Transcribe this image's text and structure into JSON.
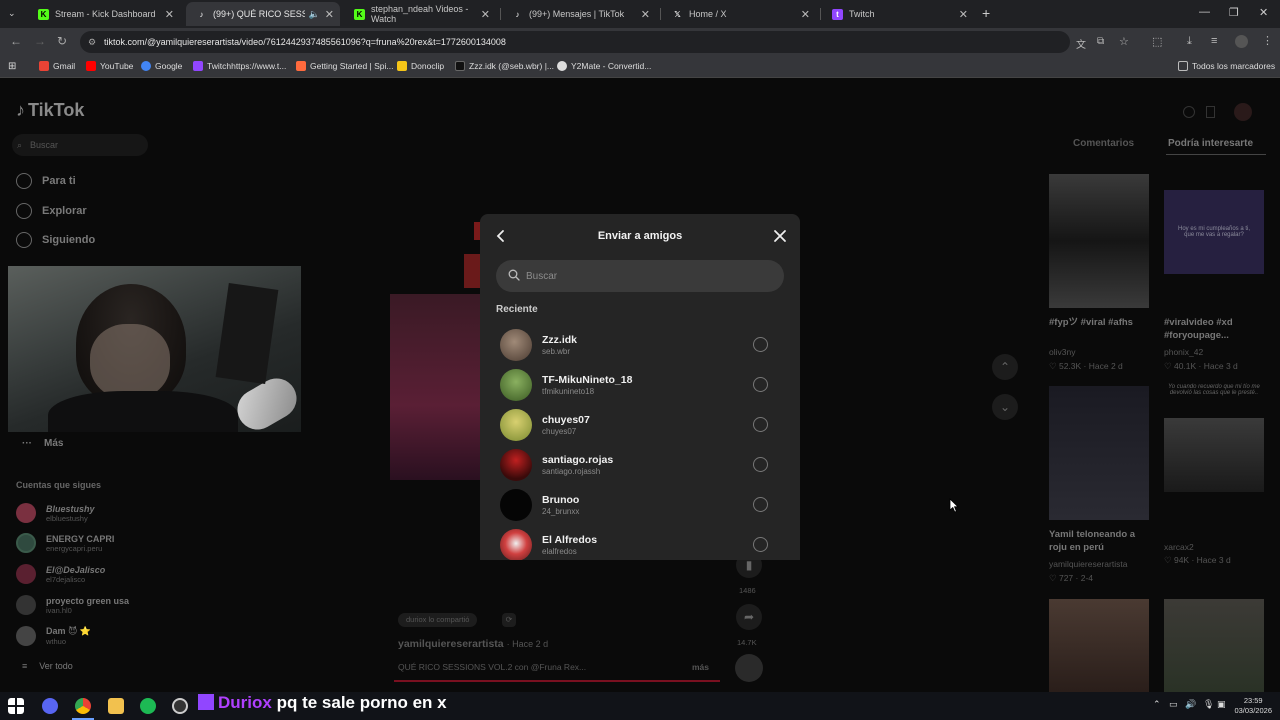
{
  "browser": {
    "tabs": [
      {
        "label": "Stream - Kick Dashboard",
        "favicon_color": "#53fc18"
      },
      {
        "label": "(99+) QUÉ RICO SESSIONS V",
        "favicon_color": "#ffffff"
      },
      {
        "label": "stephan_ndeah Videos - Watch",
        "favicon_color": "#53fc18"
      },
      {
        "label": "(99+) Mensajes | TikTok",
        "favicon_color": "#ffffff"
      },
      {
        "label": "Home / X",
        "favicon_color": "#ffffff"
      },
      {
        "label": "Twitch",
        "favicon_color": "#9146ff"
      }
    ],
    "url": "tiktok.com/@yamilquiereserartista/video/7612442937485561096?q=fruna%20rex&t=1772600134008",
    "bookmarks": [
      {
        "label": "Gmail",
        "color": "#ea4335"
      },
      {
        "label": "YouTube",
        "color": "#ff0000"
      },
      {
        "label": "Google",
        "color": "#4285f4"
      },
      {
        "label": "Twitchhttps://www.t...",
        "color": "#9146ff"
      },
      {
        "label": "Getting Started | Spi...",
        "color": "#ff6a3d"
      },
      {
        "label": "Donoclip",
        "color": "#f5c518"
      },
      {
        "label": "Zzz.idk (@seb.wbr) |...",
        "color": "#ffffff"
      },
      {
        "label": "Y2Mate - Convertid...",
        "color": "#dddddd"
      }
    ],
    "all_bookmarks": "Todos los marcadores"
  },
  "tiktok": {
    "logo": "TikTok",
    "search_placeholder": "Buscar",
    "nav": [
      "Para ti",
      "Explorar",
      "Siguiendo"
    ],
    "more": "Más",
    "following_title": "Cuentas que sigues",
    "following": [
      {
        "name": "Bluestushy",
        "handle": "elbluestushy",
        "color": "#7a3040"
      },
      {
        "name": "ENERGY CAPRI",
        "handle": "energycapri.peru",
        "color": "#2f4a3f"
      },
      {
        "name": "El@DeJalisco",
        "handle": "el7dejalisco",
        "color": "#5a2030"
      },
      {
        "name": "proyecto green usa",
        "handle": "ivan.hl0",
        "color": "#333333"
      },
      {
        "name": "Dam 😈 ⭐",
        "handle": "wthuo",
        "color": "#444444"
      }
    ],
    "see_all": "Ver todo",
    "right_tabs": [
      "Comentarios",
      "Podría interesarte"
    ],
    "related": [
      {
        "caption": "#fypツ #viral #afhs",
        "author": "oliv3ny",
        "stats": "♡ 52.3K · Hace 2 d"
      },
      {
        "caption": "#viralvideo #xd #foryoupage...",
        "author": "phonix_42",
        "stats": "♡ 40.1K · Hace 3 d"
      },
      {
        "caption": "Yamil teloneando a roju en perú",
        "author": "yamilquiereserartista",
        "stats": "♡ 727 · 2-4"
      },
      {
        "caption": "",
        "author": "xarcax2",
        "stats": "♡ 94K · Hace 3 d"
      }
    ],
    "thumb_text_1": "Hoy es mi cumpleaños a ti, que me vas a regalar?",
    "thumb_text_2": "Yo cuando recuerdo que mi tío me devolvió las cosas que le presté..",
    "video": {
      "shared_by": "duriox lo compartió",
      "author": "yamilquiereserartista",
      "time": "· Hace 2 d",
      "description": "QUÉ RICO SESSIONS VOL.2 con @Fruna Rex...",
      "more": "más",
      "save_count": "1486",
      "share_count": "14.7K"
    }
  },
  "modal": {
    "title": "Enviar a amigos",
    "search_placeholder": "Buscar",
    "section": "Reciente",
    "friends": [
      {
        "name": "Zzz.idk",
        "username": "seb.wbr",
        "avatar_color": "#6b5a4e"
      },
      {
        "name": "TF-MikuNineto_18",
        "username": "tfmikunineto18",
        "avatar_color": "#5c8a3a"
      },
      {
        "name": "chuyes07",
        "username": "chuyes07",
        "avatar_color": "#a8b040"
      },
      {
        "name": "santiago.rojas",
        "username": "santiago.rojassh",
        "avatar_color": "#8b1a1a"
      },
      {
        "name": "Brunoo",
        "username": "24_brunxx",
        "avatar_color": "#0a0a0a"
      },
      {
        "name": "El Alfredos",
        "username": "elalfredos",
        "avatar_color": "#b83030"
      }
    ]
  },
  "stream_overlay": {
    "user": "Duriox",
    "message": "pq te sale porno en x",
    "user_color": "#b040ff"
  },
  "system": {
    "time": "23:59",
    "date": "03/03/2026"
  }
}
